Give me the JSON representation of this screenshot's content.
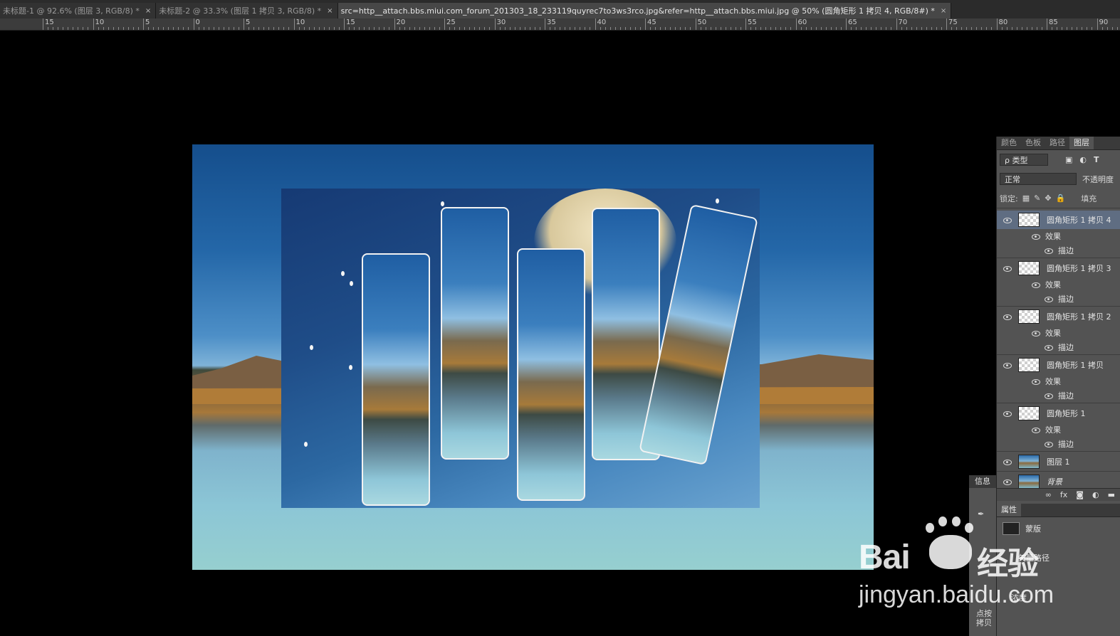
{
  "tabs": [
    {
      "label": "未标题-1 @ 92.6% (图层 3, RGB/8) *",
      "active": false
    },
    {
      "label": "未标题-2 @ 33.3% (图层 1 拷贝 3, RGB/8) *",
      "active": false
    },
    {
      "label": "src=http__attach.bbs.miui.com_forum_201303_18_233119quyrec7to3ws3rco.jpg&refer=http__attach.bbs.miui.jpg @ 50% (圆角矩形 1 拷贝 4, RGB/8#) *",
      "active": true
    }
  ],
  "tab_close": "×",
  "ruler": [
    "15",
    "10",
    "5",
    "0",
    "5",
    "10",
    "15",
    "20",
    "25",
    "30",
    "35",
    "40",
    "45",
    "50",
    "55",
    "60",
    "65",
    "70",
    "75",
    "80",
    "85",
    "90"
  ],
  "layers_panel": {
    "tabs": [
      "颜色",
      "色板",
      "路径",
      "图层"
    ],
    "active_tab": "图层",
    "filter_label": "ρ 类型",
    "blend_mode": "正常",
    "opacity_label": "不透明度",
    "lock_label": "锁定:",
    "fill_label": "填充",
    "layers": [
      {
        "name": "圆角矩形 1 拷贝 4",
        "selected": true,
        "effects": [
          "效果",
          "描边"
        ]
      },
      {
        "name": "圆角矩形 1 拷贝 3",
        "selected": false,
        "effects": [
          "效果",
          "描边"
        ]
      },
      {
        "name": "圆角矩形 1 拷贝 2",
        "selected": false,
        "effects": [
          "效果",
          "描边"
        ]
      },
      {
        "name": "圆角矩形 1 拷贝",
        "selected": false,
        "effects": [
          "效果",
          "描边"
        ]
      },
      {
        "name": "圆角矩形 1",
        "selected": false,
        "effects": [
          "效果",
          "描边"
        ]
      },
      {
        "name": "图层 1",
        "selected": false,
        "effects": []
      },
      {
        "name": "背景",
        "selected": false,
        "effects": []
      }
    ]
  },
  "info_panel": {
    "tab": "信息",
    "footer": "点按拷贝"
  },
  "properties_panel": {
    "tab": "属性",
    "mask_label": "蒙版",
    "path_label": "矢量路径",
    "density_label": "浓度"
  },
  "watermark": {
    "brand": "Bai",
    "brand_cn": "经验",
    "url": "jingyan.baidu.com"
  }
}
